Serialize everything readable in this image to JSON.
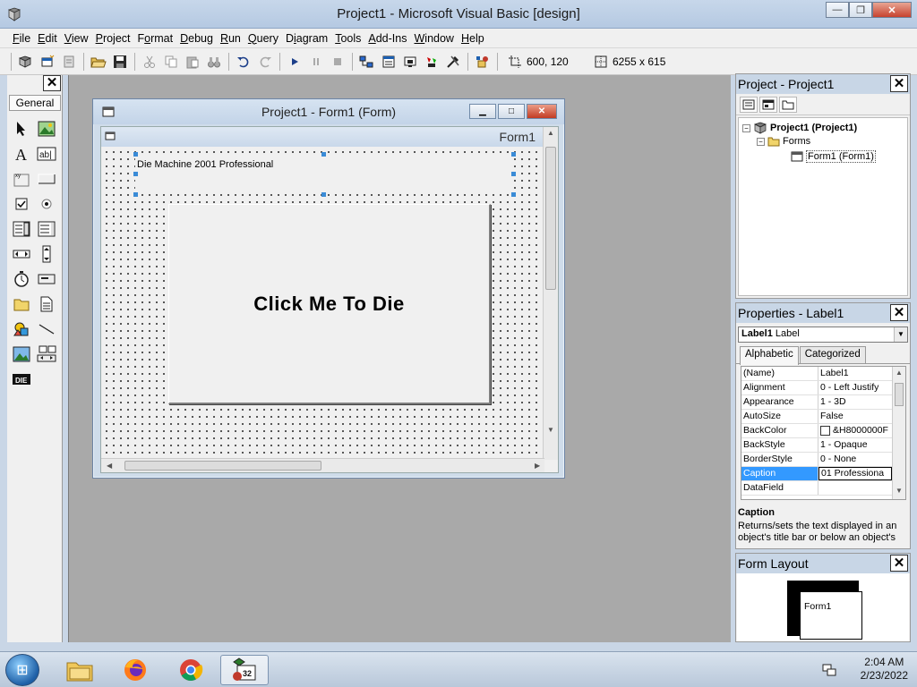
{
  "window": {
    "title": "Project1 - Microsoft Visual Basic [design]",
    "min_label": "—",
    "restore_label": "❐",
    "close_label": "✕"
  },
  "menu": [
    {
      "acc": "F",
      "rest": "ile"
    },
    {
      "acc": "E",
      "rest": "dit"
    },
    {
      "acc": "V",
      "rest": "iew"
    },
    {
      "acc": "P",
      "rest": "roject"
    },
    {
      "pre": "F",
      "acc": "o",
      "rest": "rmat"
    },
    {
      "acc": "D",
      "rest": "ebug"
    },
    {
      "acc": "R",
      "rest": "un"
    },
    {
      "acc": "Q",
      "rest": "uery"
    },
    {
      "pre": "D",
      "acc": "i",
      "rest": "agram"
    },
    {
      "acc": "T",
      "rest": "ools"
    },
    {
      "acc": "A",
      "pre2": "Add-",
      "rest": ""
    },
    {
      "acc": "W",
      "rest": "indow"
    },
    {
      "acc": "H",
      "rest": "elp"
    }
  ],
  "menu_labels": [
    "File",
    "Edit",
    "View",
    "Project",
    "Format",
    "Debug",
    "Run",
    "Query",
    "Diagram",
    "Tools",
    "Add-Ins",
    "Window",
    "Help"
  ],
  "toolbar": {
    "position": "600, 120",
    "size": "6255 x 615"
  },
  "toolbox": {
    "tab": "General",
    "close_label": "✕",
    "tools": [
      "pointer-icon",
      "picturebox-icon",
      "label-icon",
      "textbox-icon",
      "frame-icon",
      "commandbutton-icon",
      "checkbox-icon",
      "optionbutton-icon",
      "combobox-icon",
      "listbox-icon",
      "hscrollbar-icon",
      "vscrollbar-icon",
      "timer-icon",
      "drivelistbox-icon",
      "dirlistbox-icon",
      "filelistbox-icon",
      "shape-icon",
      "line-icon",
      "image-icon",
      "data-icon",
      "ole-icon"
    ],
    "custom_tool_label": "DIE"
  },
  "form_window": {
    "title": "Project1 - Form1 (Form)",
    "form_caption": "Form1",
    "label1_caption": "Die Machine 2001 Professional",
    "command_caption": "Click Me To Die"
  },
  "project_pane": {
    "title": "Project - Project1",
    "root": "Project1 (Project1)",
    "folder": "Forms",
    "item": "Form1 (Form1)"
  },
  "properties_pane": {
    "title": "Properties - Label1",
    "object_bold": "Label1",
    "object_type": "Label",
    "tabs": [
      "Alphabetic",
      "Categorized"
    ],
    "rows": [
      {
        "name": "(Name)",
        "value": "Label1"
      },
      {
        "name": "Alignment",
        "value": "0 - Left Justify"
      },
      {
        "name": "Appearance",
        "value": "1 - 3D"
      },
      {
        "name": "AutoSize",
        "value": "False"
      },
      {
        "name": "BackColor",
        "value": "&H8000000F"
      },
      {
        "name": "BackStyle",
        "value": "1 - Opaque"
      },
      {
        "name": "BorderStyle",
        "value": "0 - None"
      },
      {
        "name": "Caption",
        "value": "01 Professiona"
      },
      {
        "name": "DataField",
        "value": ""
      }
    ],
    "desc_title": "Caption",
    "desc_text": "Returns/sets the text displayed in an object's title bar or below an object's"
  },
  "layout_pane": {
    "title": "Form Layout",
    "form_label": "Form1"
  },
  "taskbar": {
    "time": "2:04 AM",
    "date": "2/23/2022",
    "vb_badge": "32"
  },
  "colors": {
    "selection": "#3399ff",
    "handle": "#3a8bd6",
    "mdi_background": "#a9a9a9"
  }
}
